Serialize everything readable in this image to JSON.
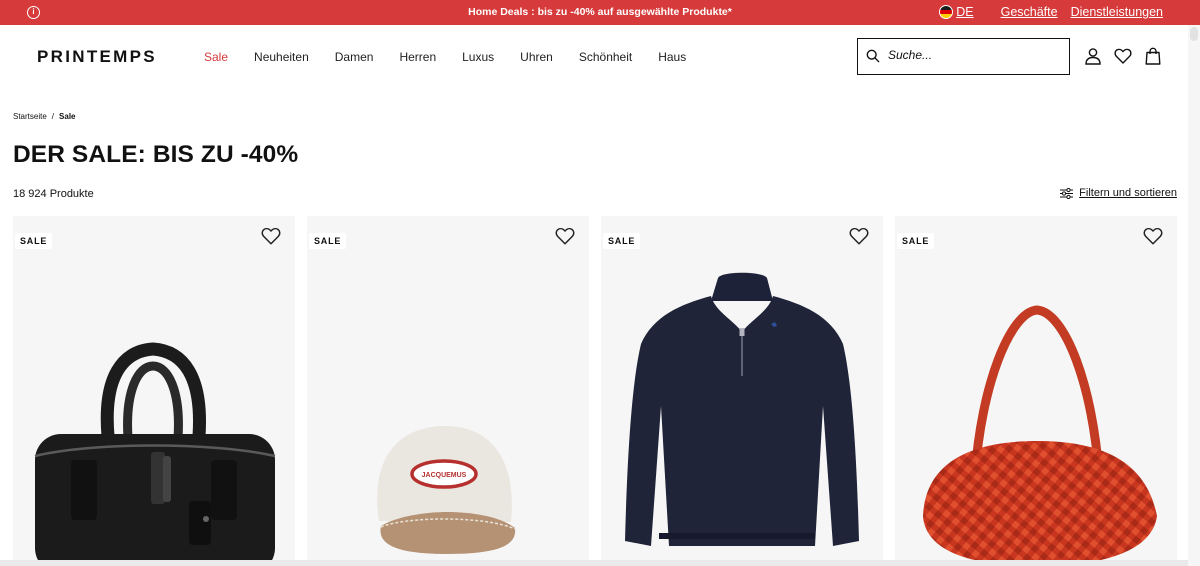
{
  "promo": {
    "text": "Home Deals : bis zu -40% auf ausgewählte Produkte*",
    "country": "DE",
    "links": [
      "Geschäfte",
      "Dienstleistungen"
    ],
    "bg_color": "#d63a3a"
  },
  "header": {
    "logo": "PRINTEMPS",
    "nav": [
      "Sale",
      "Neuheiten",
      "Damen",
      "Herren",
      "Luxus",
      "Uhren",
      "Schönheit",
      "Haus"
    ],
    "active_nav": "Sale",
    "search_placeholder": "Suche...",
    "icons": [
      "account-icon",
      "wishlist-icon",
      "shopping-bag-icon"
    ]
  },
  "breadcrumb": {
    "home": "Startseite",
    "separator": "/",
    "current": "Sale"
  },
  "page": {
    "title": "DER SALE: BIS ZU -40%",
    "count": "18 924 Produkte",
    "filter_label": "Filtern und sortieren"
  },
  "products": [
    {
      "badge": "SALE",
      "image": "black-leather-duffel-bag"
    },
    {
      "badge": "SALE",
      "image": "jacquemus-cap",
      "brand_text": "JACQUEMUS"
    },
    {
      "badge": "SALE",
      "image": "navy-half-zip-sweater"
    },
    {
      "badge": "SALE",
      "image": "red-woven-shoulder-bag"
    }
  ]
}
